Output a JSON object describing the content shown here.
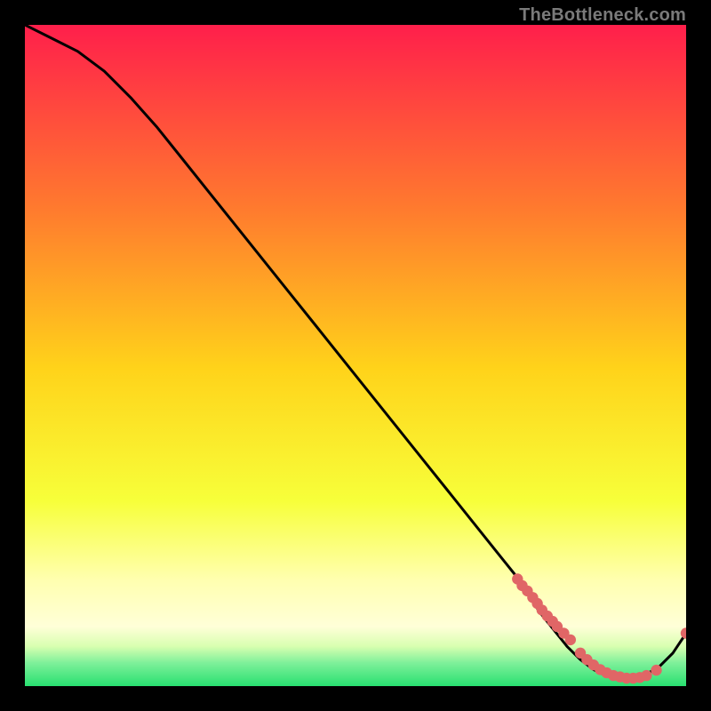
{
  "watermark": "TheBottleneck.com",
  "colors": {
    "top": "#ff1f4b",
    "mid_upper": "#ff7b2e",
    "mid": "#ffd31a",
    "mid_lower": "#f7ff3a",
    "pale_yellow": "#ffffb0",
    "green": "#28e070",
    "curve_stroke": "#000000",
    "marker_fill": "#e06666",
    "marker_stroke": "#cc4444"
  },
  "chart_data": {
    "type": "line",
    "title": "",
    "xlabel": "",
    "ylabel": "",
    "xlim": [
      0,
      100
    ],
    "ylim": [
      0,
      100
    ],
    "grid": false,
    "legend": false,
    "series": [
      {
        "name": "bottleneck-curve",
        "x": [
          0,
          4,
          8,
          12,
          16,
          20,
          24,
          28,
          32,
          36,
          40,
          44,
          48,
          52,
          56,
          60,
          64,
          68,
          72,
          74,
          76,
          78,
          80,
          82,
          84,
          86,
          88,
          90,
          92,
          94,
          96,
          98,
          100
        ],
        "y": [
          100,
          98,
          96,
          93,
          89,
          84.5,
          79.5,
          74.5,
          69.5,
          64.5,
          59.5,
          54.5,
          49.5,
          44.5,
          39.5,
          34.5,
          29.5,
          24.5,
          19.5,
          17,
          14,
          11,
          8.5,
          6,
          4,
          2.5,
          1.5,
          1.2,
          1.2,
          1.8,
          3,
          5,
          8
        ]
      }
    ],
    "markers": {
      "name": "highlight-points",
      "x": [
        74.5,
        75.2,
        76.0,
        76.8,
        77.5,
        78.2,
        79.0,
        79.8,
        80.5,
        81.5,
        82.5,
        84.0,
        85.0,
        86.0,
        87.0,
        88.0,
        89.0,
        90.0,
        91.0,
        92.0,
        93.0,
        94.0,
        95.5,
        100.0
      ],
      "y": [
        16.2,
        15.2,
        14.4,
        13.4,
        12.5,
        11.5,
        10.6,
        9.8,
        9.0,
        8.0,
        7.0,
        5.0,
        4.0,
        3.2,
        2.5,
        2.0,
        1.6,
        1.4,
        1.2,
        1.2,
        1.3,
        1.6,
        2.4,
        8.0
      ]
    }
  }
}
